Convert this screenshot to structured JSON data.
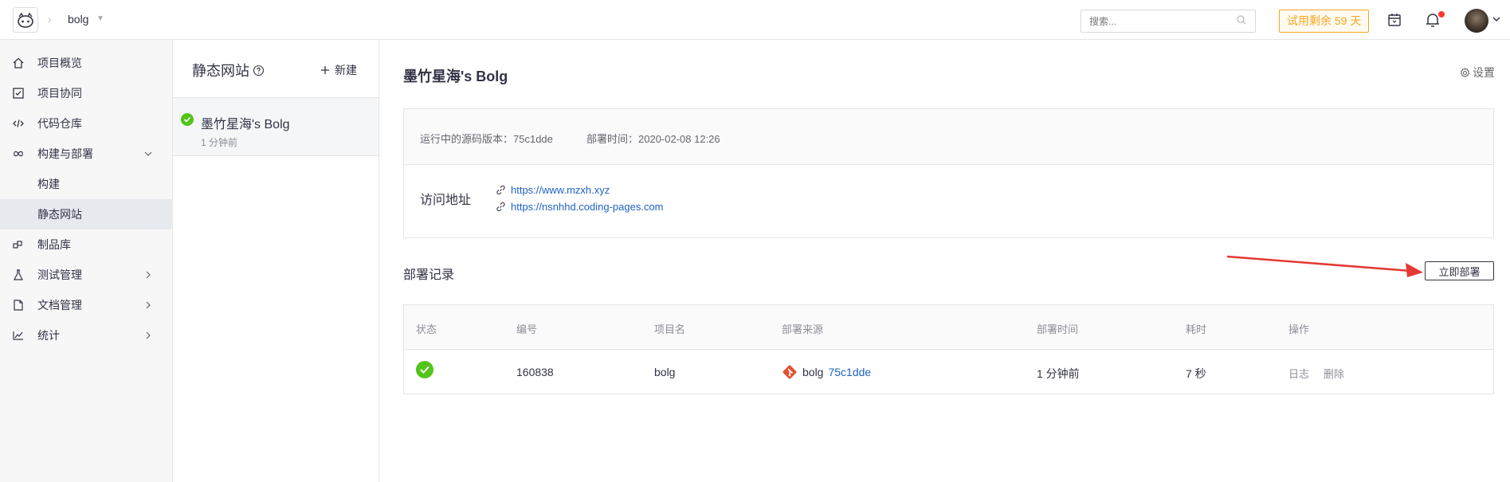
{
  "topbar": {
    "project": "bolg",
    "search_placeholder": "搜索...",
    "trial": "试用剩余 59 天"
  },
  "sidebar": {
    "items": [
      {
        "label": "项目概览",
        "icon": "home-icon"
      },
      {
        "label": "项目协同",
        "icon": "checkbox-icon"
      },
      {
        "label": "代码仓库",
        "icon": "code-icon"
      },
      {
        "label": "构建与部署",
        "icon": "infinity-icon"
      },
      {
        "label": "构建"
      },
      {
        "label": "静态网站"
      },
      {
        "label": "制品库",
        "icon": "package-icon"
      },
      {
        "label": "测试管理",
        "icon": "flask-icon"
      },
      {
        "label": "文档管理",
        "icon": "document-icon"
      },
      {
        "label": "统计",
        "icon": "chart-icon"
      }
    ]
  },
  "panel": {
    "title": "静态网站",
    "new_label": "新建",
    "site": {
      "name": "墨竹星海's Bolg",
      "time": "1 分钟前"
    }
  },
  "main": {
    "title": "墨竹星海's Bolg",
    "settings": "设置",
    "source_version": "运行中的源码版本：75c1dde",
    "deploy_time": "部署时间：2020-02-08 12:26",
    "visit_label": "访问地址",
    "links": [
      "https://www.mzxh.xyz",
      "https://nsnhhd.coding-pages.com"
    ],
    "records_title": "部署记录",
    "deploy_button": "立即部署",
    "table": {
      "headers": [
        "状态",
        "编号",
        "项目名",
        "部署来源",
        "部署时间",
        "耗时",
        "操作"
      ],
      "rows": [
        {
          "id": "160838",
          "project": "bolg",
          "source": "bolg",
          "hash": "75c1dde",
          "time": "1 分钟前",
          "duration": "7 秒",
          "log": "日志",
          "delete": "删除"
        }
      ]
    }
  },
  "colors": {
    "accent": "#1f62c5",
    "success": "#52c41a",
    "warning": "#f5a623",
    "arrow": "#e53935"
  }
}
